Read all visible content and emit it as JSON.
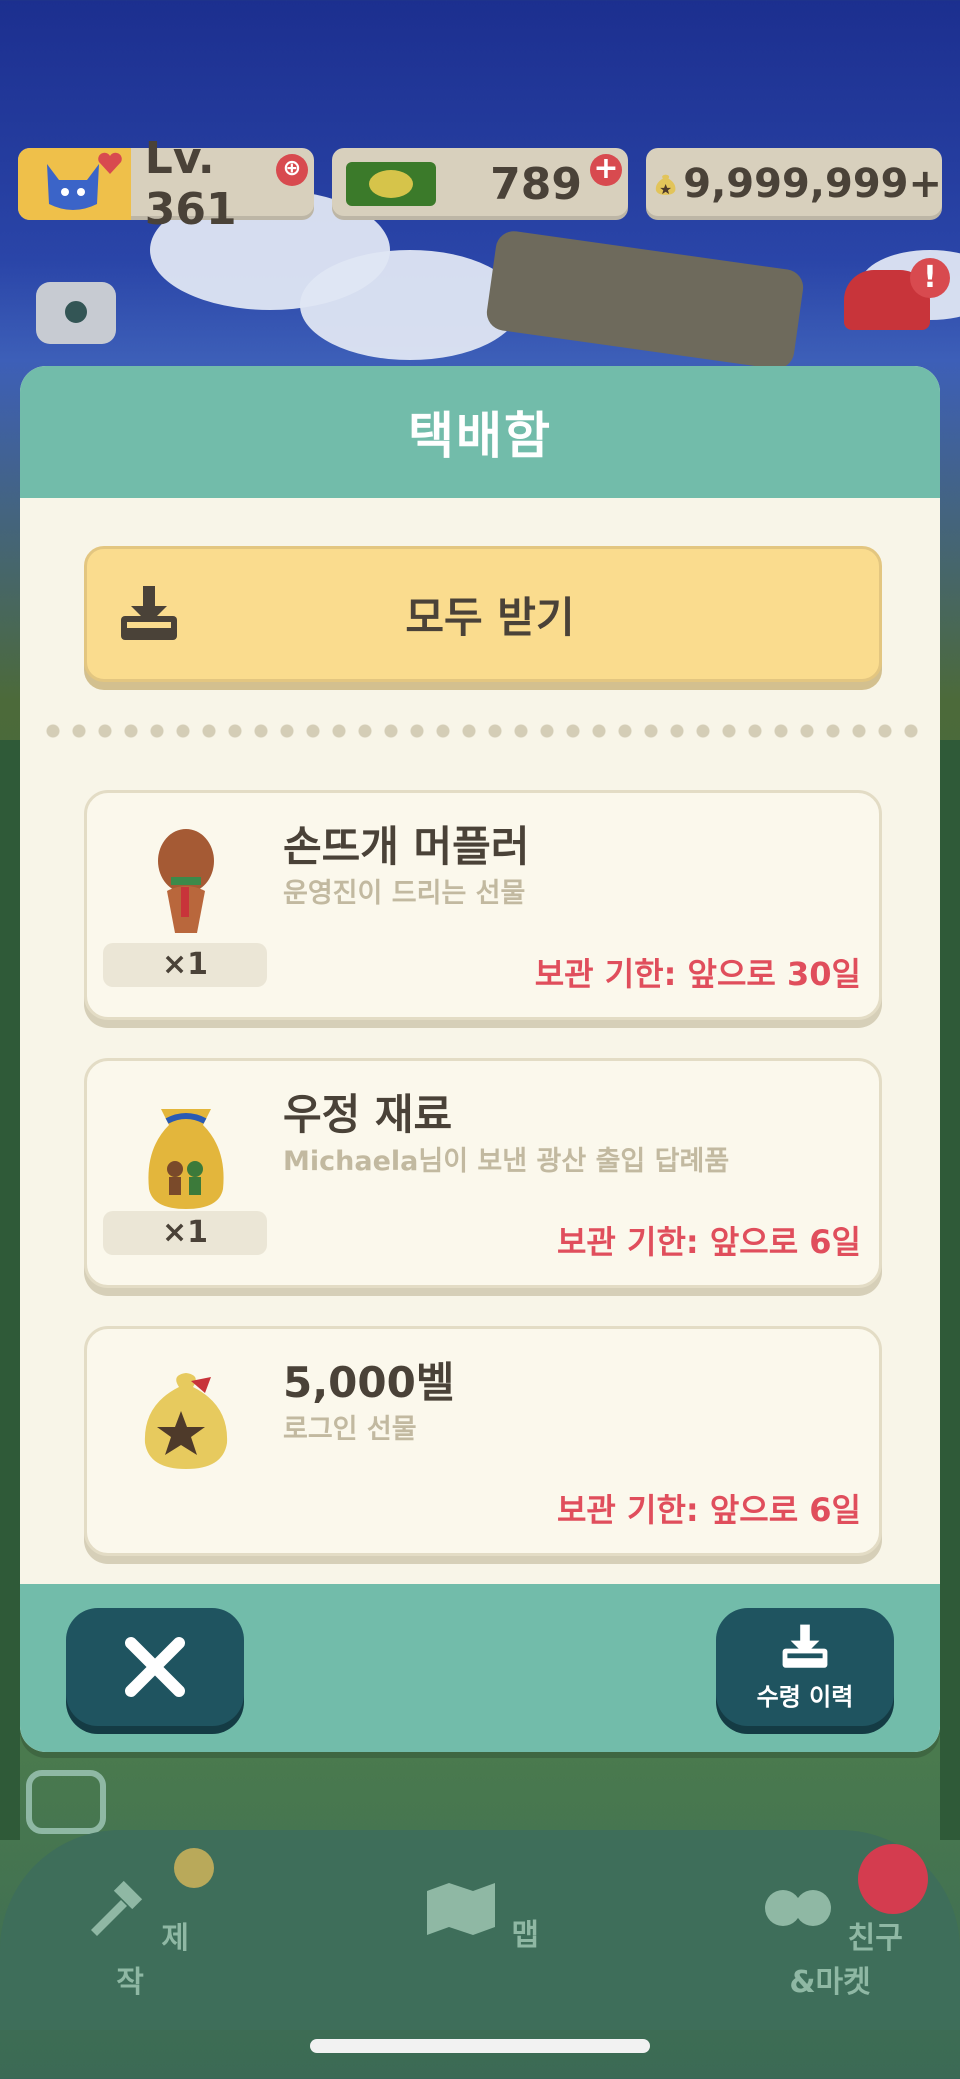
{
  "status_bar": {
    "level": "Lv. 361",
    "leaf_tickets": "789",
    "bells": "9,999,999+"
  },
  "modal": {
    "title": "택배함",
    "receive_all_label": "모두 받기",
    "items": [
      {
        "name": "손뜨개 머플러",
        "subtitle": "운영진이 드리는 선물",
        "quantity": "×1",
        "expiry": "보관 기한: 앞으로 30일"
      },
      {
        "name": "우정 재료",
        "subtitle": "Michaela님이 보낸 광산 출입 답례품",
        "quantity": "×1",
        "expiry": "보관 기한: 앞으로 6일"
      },
      {
        "name": "5,000벨",
        "subtitle": "로그인 선물",
        "quantity": "",
        "expiry": "보관 기한: 앞으로 6일"
      }
    ],
    "history_label": "수령 이력"
  },
  "bottom_nav": {
    "craft_label": "제작",
    "map_label": "맵",
    "friends_label": "친구&마켓"
  },
  "colors": {
    "modal_header": "#72bcaa",
    "accent_yellow": "#fadc8e",
    "expiry_red": "#e04e5c",
    "dark_button": "#1f5460"
  }
}
